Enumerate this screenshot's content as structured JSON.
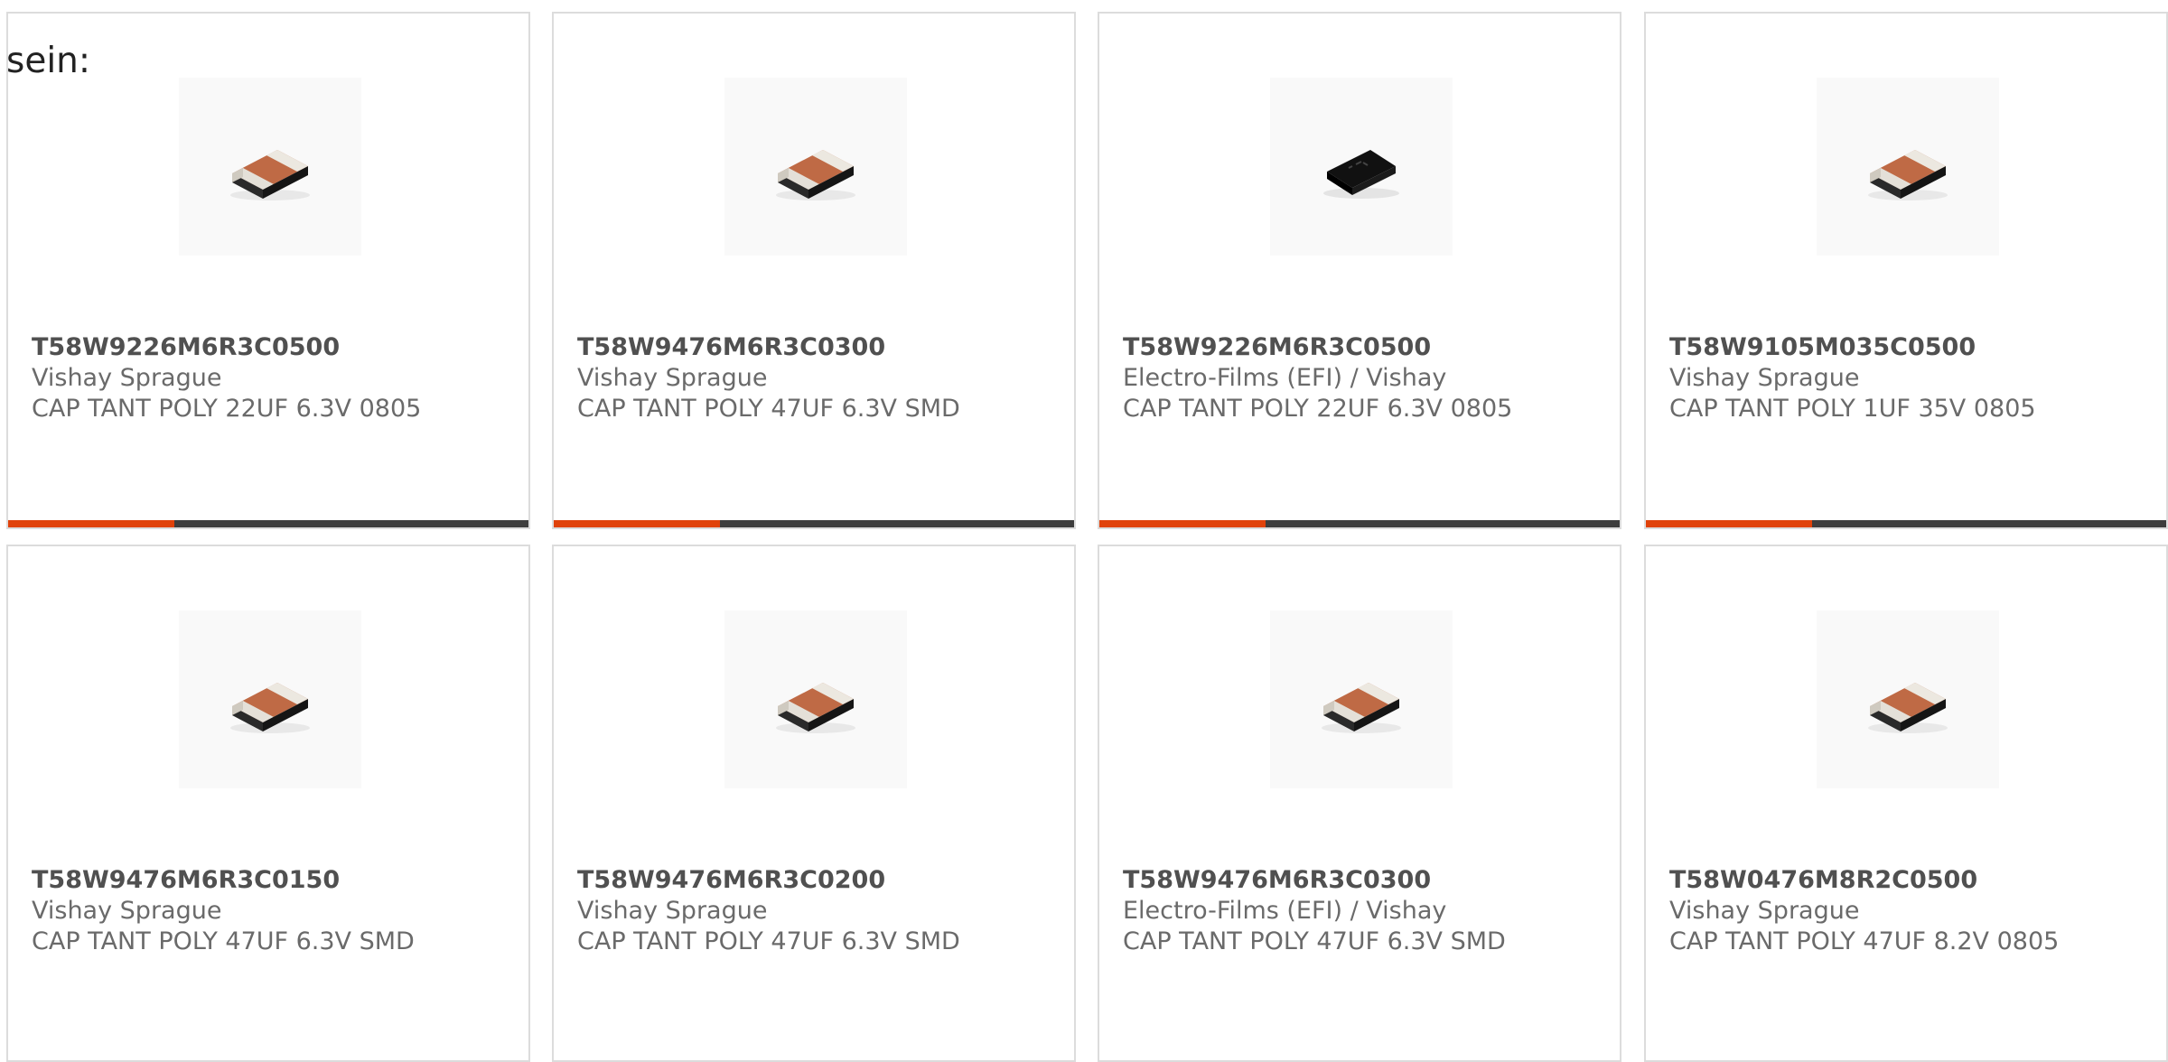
{
  "intro_text": "sein:",
  "colors": {
    "accent": "#e0420a",
    "bar_track": "#3d3d3d",
    "card_border": "#dcdcdc"
  },
  "progress_fraction": 0.32,
  "products": [
    {
      "part_number": "T58W9226M6R3C0500",
      "manufacturer": "Vishay Sprague",
      "description": "CAP TANT POLY 22UF 6.3V 0805",
      "image_icon": "tantalum-chip-capacitor-icon"
    },
    {
      "part_number": "T58W9476M6R3C0300",
      "manufacturer": "Vishay Sprague",
      "description": "CAP TANT POLY 47UF 6.3V SMD",
      "image_icon": "tantalum-chip-capacitor-icon"
    },
    {
      "part_number": "T58W9226M6R3C0500",
      "manufacturer": "Electro-Films (EFI) / Vishay",
      "description": "CAP TANT POLY 22UF 6.3V 0805",
      "image_icon": "black-chip-capacitor-icon"
    },
    {
      "part_number": "T58W9105M035C0500",
      "manufacturer": "Vishay Sprague",
      "description": "CAP TANT POLY 1UF 35V 0805",
      "image_icon": "tantalum-chip-capacitor-icon"
    },
    {
      "part_number": "T58W9476M6R3C0150",
      "manufacturer": "Vishay Sprague",
      "description": "CAP TANT POLY 47UF 6.3V SMD",
      "image_icon": "tantalum-chip-capacitor-icon"
    },
    {
      "part_number": "T58W9476M6R3C0200",
      "manufacturer": "Vishay Sprague",
      "description": "CAP TANT POLY 47UF 6.3V SMD",
      "image_icon": "tantalum-chip-capacitor-icon"
    },
    {
      "part_number": "T58W9476M6R3C0300",
      "manufacturer": "Electro-Films (EFI) / Vishay",
      "description": "CAP TANT POLY 47UF 6.3V SMD",
      "image_icon": "tantalum-chip-capacitor-icon"
    },
    {
      "part_number": "T58W0476M8R2C0500",
      "manufacturer": "Vishay Sprague",
      "description": "CAP TANT POLY 47UF 8.2V 0805",
      "image_icon": "tantalum-chip-capacitor-icon"
    }
  ]
}
